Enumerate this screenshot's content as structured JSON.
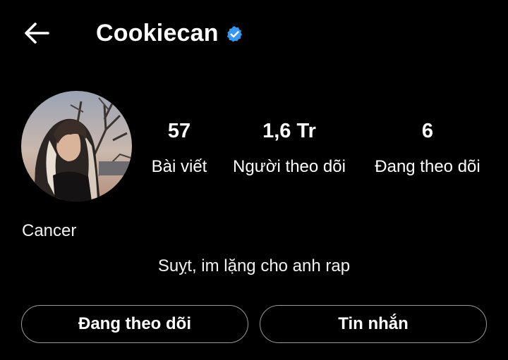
{
  "header": {
    "back_icon": "arrow-left-icon",
    "username": "Cookiecan",
    "verified_icon": "verified-badge-icon",
    "verified_color": "#3897f0"
  },
  "profile": {
    "avatar_icon": "profile-photo",
    "stats": [
      {
        "value": "57",
        "label": "Bài viết"
      },
      {
        "value": "1,6 Tr",
        "label": "Người theo dõi"
      },
      {
        "value": "6",
        "label": "Đang theo dõi"
      }
    ],
    "category": "Cancer",
    "bio": "Suỵt, im lặng cho anh rap"
  },
  "actions": {
    "following_label": "Đang theo dõi",
    "message_label": "Tin nhắn"
  },
  "colors": {
    "background": "#000000",
    "text": "#ffffff",
    "button_border": "#9a9a9a"
  }
}
